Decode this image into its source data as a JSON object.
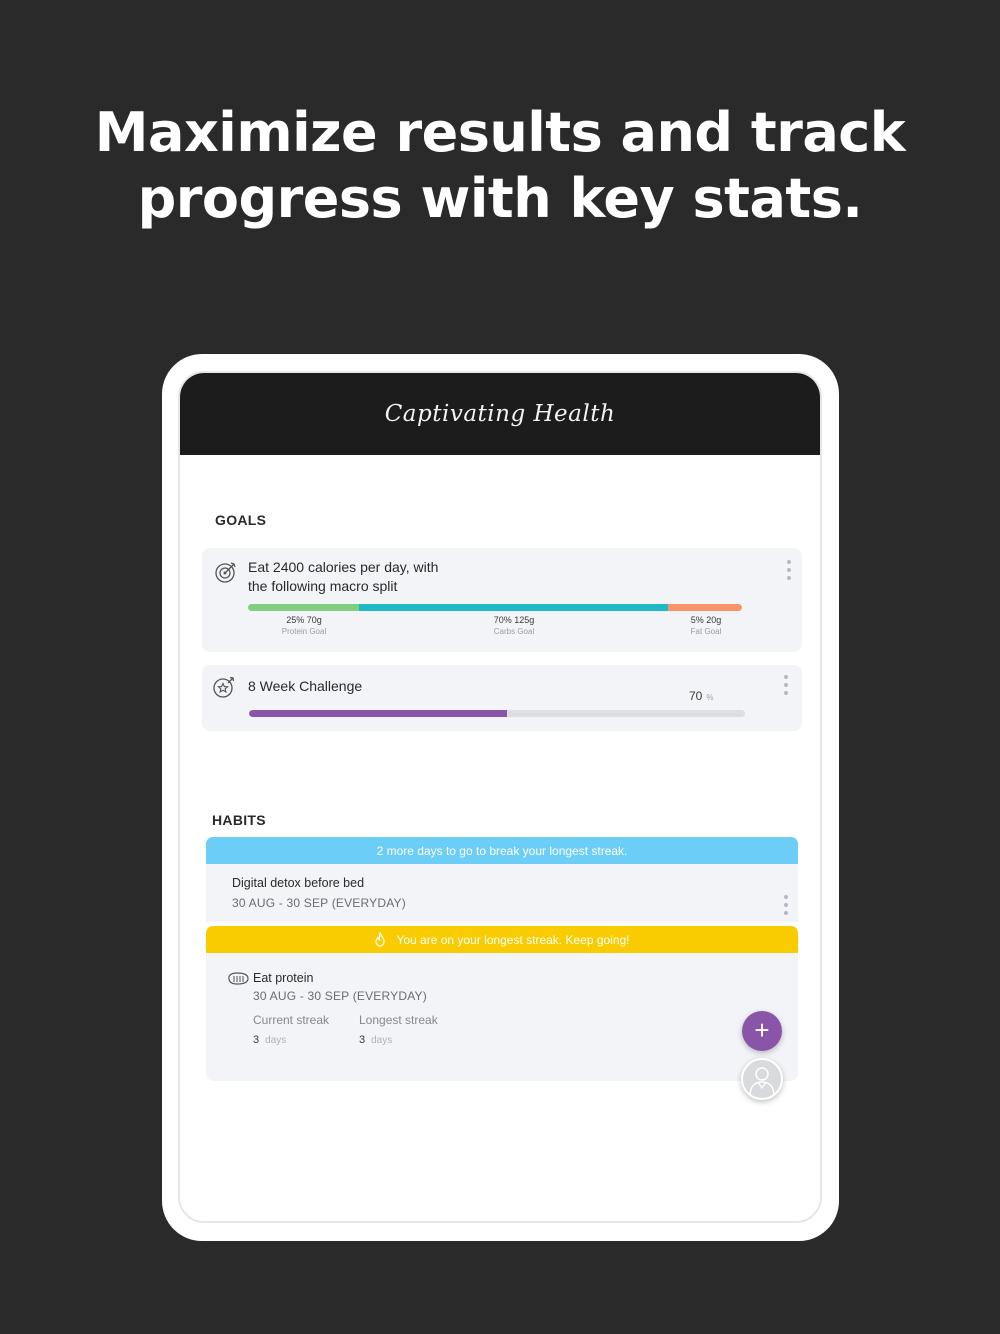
{
  "headline": {
    "line1": "Maximize results and track",
    "line2": "progress with key stats."
  },
  "app": {
    "logo_text": "Captivating Health"
  },
  "goals": {
    "section_title": "GOALS",
    "macro_goal": {
      "title_line1": "Eat 2400 calories per day, with",
      "title_line2": "the following macro split",
      "icon": "target-icon",
      "macros": [
        {
          "value": "25% 70g",
          "caption": "Protein Goal",
          "percent": 22.5,
          "color": "#7ed07e"
        },
        {
          "value": "70% 125g",
          "caption": "Carbs Goal",
          "percent": 62.5,
          "color": "#1fb8c4"
        },
        {
          "value": "5% 20g",
          "caption": "Fat Goal",
          "percent": 15,
          "color": "#f7946b"
        }
      ]
    },
    "challenge": {
      "title": "8 Week Challenge",
      "icon": "target-star-icon",
      "progress_value": "70",
      "progress_unit": "%",
      "progress_fill": 0.52,
      "fill_color": "#8a55a8"
    }
  },
  "habits": {
    "section_title": "HABITS",
    "items": [
      {
        "banner": "2 more days to go to break your longest streak.",
        "banner_color": "#6ccdf7",
        "name": "Digital detox before bed",
        "dates": "30 AUG - 30 SEP  (EVERYDAY)"
      },
      {
        "banner": "You are on your longest streak. Keep going!",
        "banner_color": "#f8cc00",
        "banner_icon": "flame-icon",
        "name": "Eat protein",
        "icon": "steak-icon",
        "dates": "30 AUG - 30 SEP  (EVERYDAY)",
        "current_streak_label": "Current streak",
        "current_streak_value": "3",
        "current_streak_unit": "days",
        "longest_streak_label": "Longest streak",
        "longest_streak_value": "3",
        "longest_streak_unit": "days"
      }
    ]
  },
  "fab": {
    "add_symbol": "+",
    "avatar_icon": "coach-avatar-icon"
  }
}
